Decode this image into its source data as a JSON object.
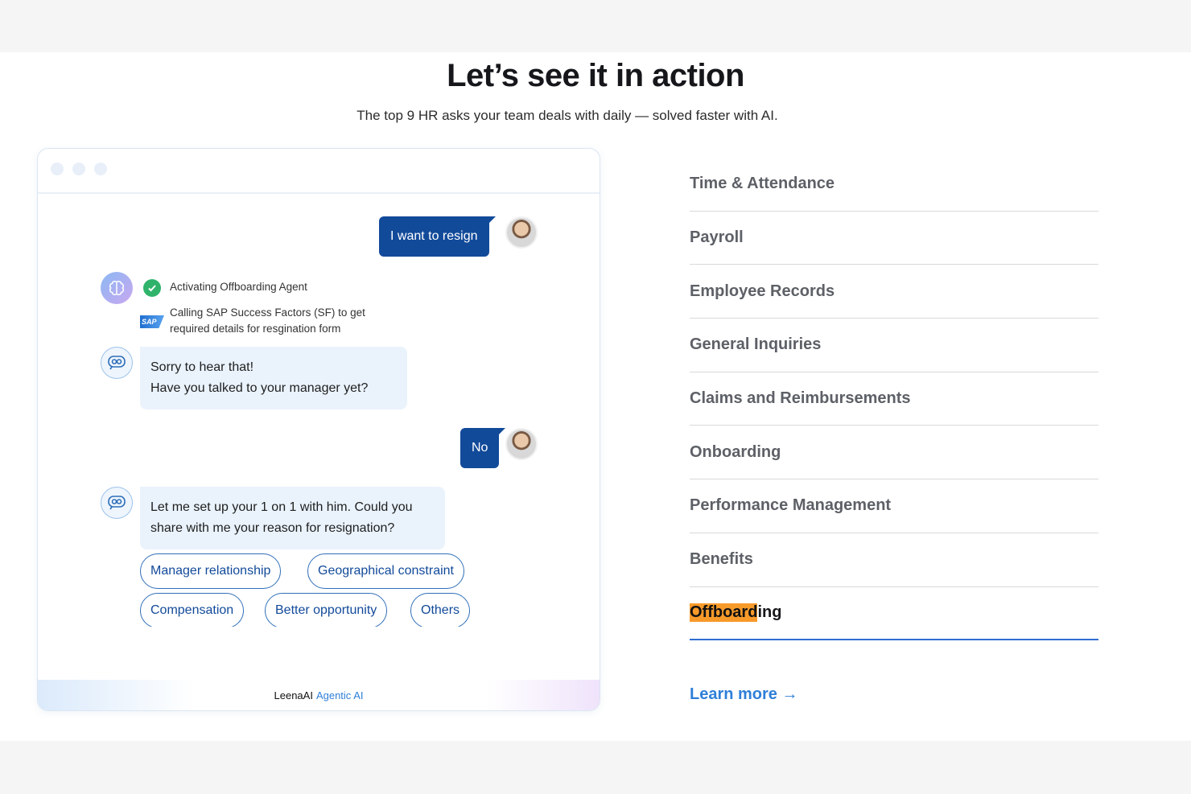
{
  "header": {
    "title": "Let’s see it in action",
    "subtitle": "The top 9 HR asks your team deals with daily — solved faster with AI."
  },
  "chat": {
    "messages": {
      "user_1": "I want to resign",
      "status_1": "Activating Offboarding Agent",
      "status_2_line1": "Calling SAP Success Factors (SF) to get",
      "status_2_line2": "required details for resgination form",
      "sap_label": "SAP",
      "bot_1_line1": "Sorry to hear that!",
      "bot_1_line2": "Have you talked to your manager yet?",
      "user_2": "No",
      "bot_2_line1": "Let me set up your 1 on 1 with him. Could you",
      "bot_2_line2": "share with me your reason for resignation?"
    },
    "options": [
      "Manager relationship",
      "Geographical constraint",
      "Compensation",
      "Better opportunity",
      "Others"
    ],
    "footer": {
      "brand": "LeenaAI",
      "tagline": "Agentic AI"
    }
  },
  "topics": {
    "items": [
      "Time & Attendance",
      "Payroll",
      "Employee Records",
      "General Inquiries",
      "Claims and Reimbursements",
      "Onboarding",
      "Performance Management",
      "Benefits"
    ],
    "active_highlight": "Offboard",
    "active_rest": "ing"
  },
  "cta": {
    "learn_more": "Learn more →"
  },
  "colors": {
    "primary": "#124a9a",
    "accent": "#2f7fd8",
    "highlight": "#f79a2a",
    "bot_bubble": "#eaf3fc",
    "check": "#2fb36a"
  }
}
